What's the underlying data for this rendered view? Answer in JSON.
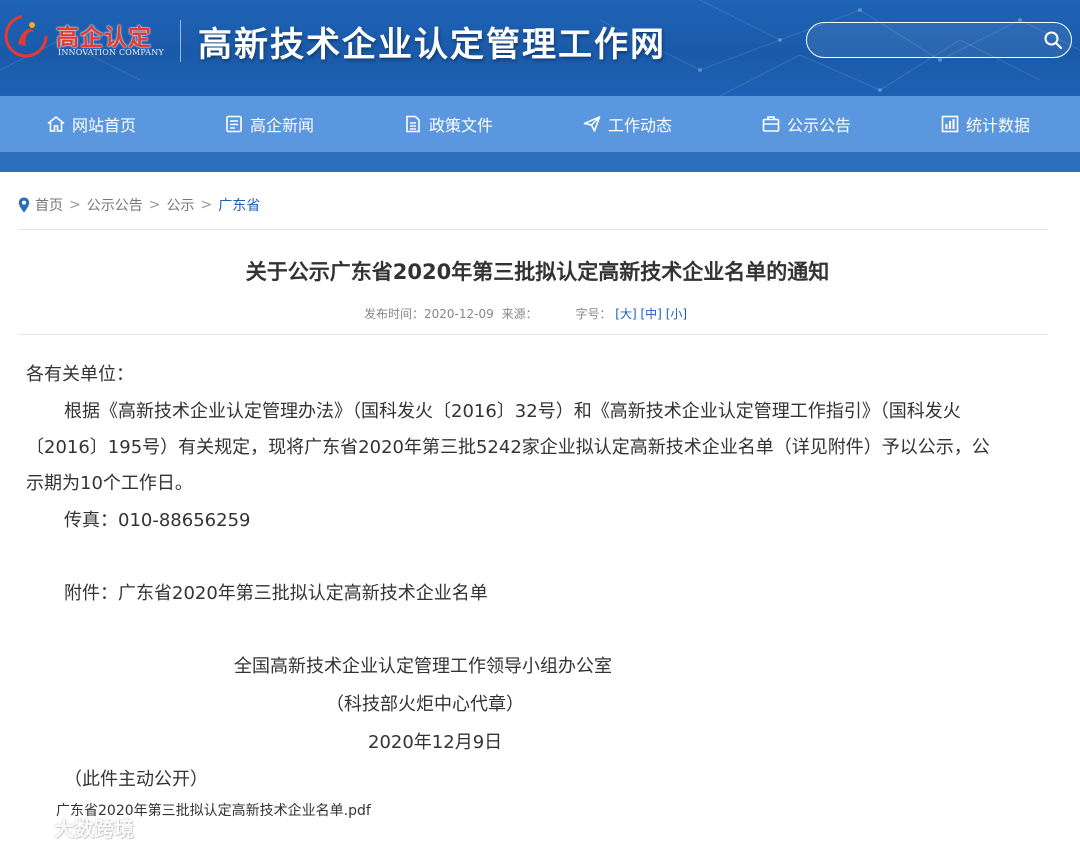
{
  "header": {
    "logo_cn": "高企认定",
    "logo_en": "INNOVATION COMPANY",
    "site_title": "高新技术企业认定管理工作网",
    "search": {
      "value": "",
      "placeholder": ""
    },
    "colors": {
      "header_bg": "#1f63b6",
      "logo_red": "#e23b32"
    }
  },
  "nav": {
    "items": [
      {
        "label": "网站首页",
        "icon": "home-icon"
      },
      {
        "label": "高企新闻",
        "icon": "news-icon"
      },
      {
        "label": "政策文件",
        "icon": "document-icon"
      },
      {
        "label": "工作动态",
        "icon": "send-icon"
      },
      {
        "label": "公示公告",
        "icon": "briefcase-icon"
      },
      {
        "label": "统计数据",
        "icon": "chart-icon"
      }
    ],
    "bg_color": "#5b97de"
  },
  "breadcrumb": {
    "items": [
      "首页",
      "公示公告",
      "公示",
      "广东省"
    ],
    "separator": ">"
  },
  "article": {
    "title": "关于公示广东省2020年第三批拟认定高新技术企业名单的通知",
    "meta": {
      "publish_label": "发布时间：",
      "publish_date": "2020-12-09",
      "source_label": "来源：",
      "font_label": "字号：",
      "font_large": "[大]",
      "font_medium": "[中]",
      "font_small": "[小]"
    },
    "salutation": "各有关单位：",
    "paragraph_lines": [
      "根据《高新技术企业认定管理办法》（国科发火〔2016〕32号）和《高新技术企业认定管理工作指引》（国科发火",
      "〔2016〕195号）有关规定，现将广东省2020年第三批5242家企业拟认定高新技术企业名单（详见附件）予以公示，公",
      "示期为10个工作日。"
    ],
    "fax": "传真：010-88656259",
    "attachment_line": "附件：广东省2020年第三批拟认定高新技术企业名单",
    "signature_org": "全国高新技术企业认定管理工作领导小组办公室",
    "signature_note": "（科技部火炬中心代章）",
    "signature_date": "2020年12月9日",
    "public_note": "（此件主动公开）",
    "attachment_file": "广东省2020年第三批拟认定高新技术企业名单.pdf"
  },
  "watermark": {
    "text": "大数跨境"
  }
}
